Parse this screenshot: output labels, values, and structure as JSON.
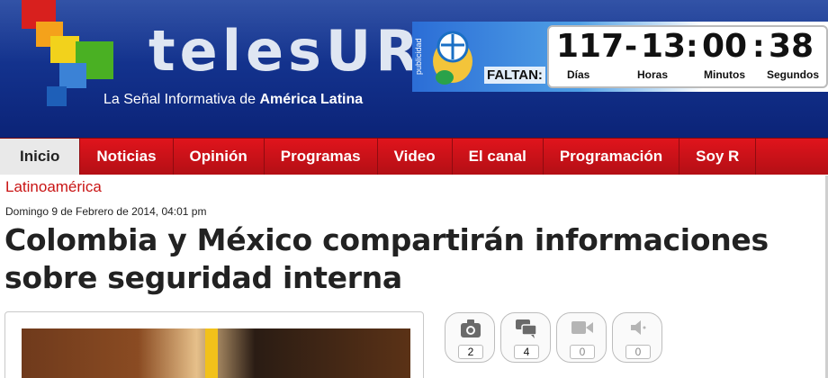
{
  "brand": {
    "logo_text": "telesUR",
    "tagline_pre": "La Señal Informativa de ",
    "tagline_bold": "América Latina"
  },
  "ad": {
    "publicidad": "publicidad",
    "faltan": "FALTAN:",
    "days": "117",
    "hours": "13",
    "minutes": "00",
    "seconds": "38",
    "days_label": "Días",
    "hours_label": "Horas",
    "minutes_label": "Minutos",
    "seconds_label": "Segundos"
  },
  "nav": {
    "items": [
      {
        "label": "Inicio"
      },
      {
        "label": "Noticias"
      },
      {
        "label": "Opinión"
      },
      {
        "label": "Programas"
      },
      {
        "label": "Video"
      },
      {
        "label": "El canal"
      },
      {
        "label": "Programación"
      },
      {
        "label": "Soy R"
      }
    ]
  },
  "article": {
    "category": "Latinoamérica",
    "date": "Domingo 9 de Febrero de 2014, 04:01 pm",
    "headline": "Colombia y México compartirán informaciones sobre seguridad interna"
  },
  "media": {
    "photos": "2",
    "comments": "4",
    "videos": "0",
    "audio": "0"
  },
  "colors": {
    "header_blue": "#12308a",
    "nav_red": "#d01219",
    "category_red": "#c91414"
  }
}
